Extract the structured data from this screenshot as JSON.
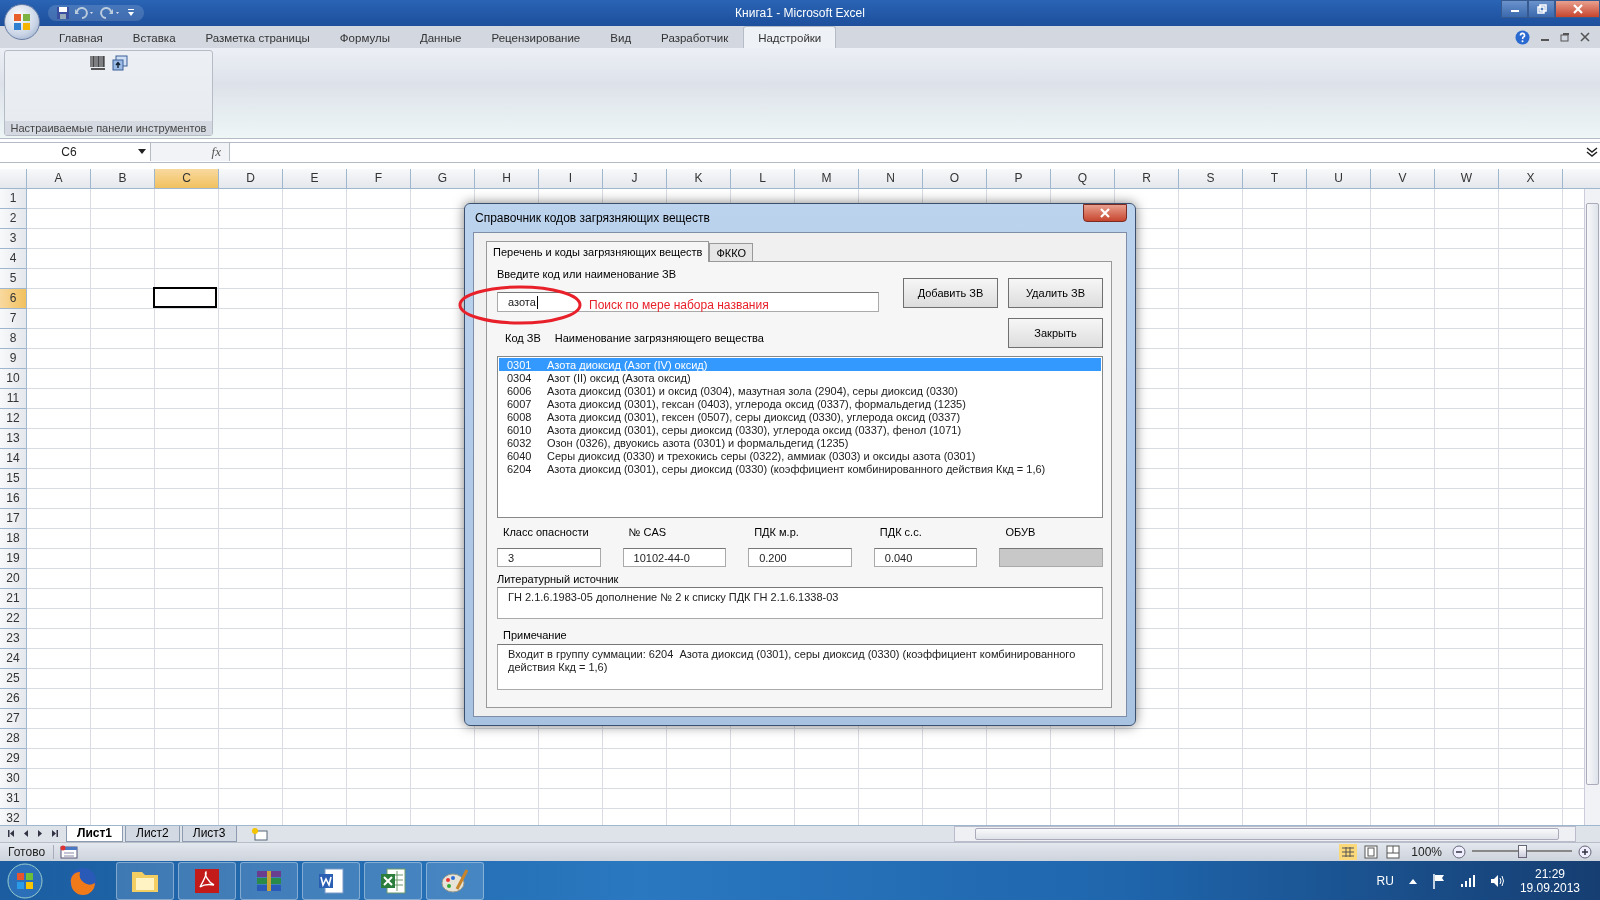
{
  "window": {
    "title": "Книга1 - Microsoft Excel"
  },
  "ribbon_tabs": [
    {
      "label": "Главная",
      "selected": false
    },
    {
      "label": "Вставка",
      "selected": false
    },
    {
      "label": "Разметка страницы",
      "selected": false
    },
    {
      "label": "Формулы",
      "selected": false
    },
    {
      "label": "Данные",
      "selected": false
    },
    {
      "label": "Рецензирование",
      "selected": false
    },
    {
      "label": "Вид",
      "selected": false
    },
    {
      "label": "Разработчик",
      "selected": false
    },
    {
      "label": "Надстройки",
      "selected": true
    }
  ],
  "ribbon_group": {
    "label": "Настраиваемые панели инструментов"
  },
  "name_box": {
    "value": "C6"
  },
  "formula_bar": {
    "function_label": "fx"
  },
  "columns": [
    {
      "label": "A",
      "selected": false
    },
    {
      "label": "B",
      "selected": false
    },
    {
      "label": "C",
      "selected": true
    },
    {
      "label": "D",
      "selected": false
    },
    {
      "label": "E",
      "selected": false
    },
    {
      "label": "F",
      "selected": false
    },
    {
      "label": "G",
      "selected": false
    },
    {
      "label": "H",
      "selected": false
    },
    {
      "label": "I",
      "selected": false
    },
    {
      "label": "J",
      "selected": false
    },
    {
      "label": "K",
      "selected": false
    },
    {
      "label": "L",
      "selected": false
    },
    {
      "label": "M",
      "selected": false
    },
    {
      "label": "N",
      "selected": false
    },
    {
      "label": "O",
      "selected": false
    },
    {
      "label": "P",
      "selected": false
    },
    {
      "label": "Q",
      "selected": false
    },
    {
      "label": "R",
      "selected": false
    },
    {
      "label": "S",
      "selected": false
    },
    {
      "label": "T",
      "selected": false
    },
    {
      "label": "U",
      "selected": false
    },
    {
      "label": "V",
      "selected": false
    },
    {
      "label": "W",
      "selected": false
    },
    {
      "label": "X",
      "selected": false
    }
  ],
  "rows": [
    {
      "label": "1",
      "selected": false
    },
    {
      "label": "2",
      "selected": false
    },
    {
      "label": "3",
      "selected": false
    },
    {
      "label": "4",
      "selected": false
    },
    {
      "label": "5",
      "selected": false
    },
    {
      "label": "6",
      "selected": true
    },
    {
      "label": "7",
      "selected": false
    },
    {
      "label": "8",
      "selected": false
    },
    {
      "label": "9",
      "selected": false
    },
    {
      "label": "10",
      "selected": false
    },
    {
      "label": "11",
      "selected": false
    },
    {
      "label": "12",
      "selected": false
    },
    {
      "label": "13",
      "selected": false
    },
    {
      "label": "14",
      "selected": false
    },
    {
      "label": "15",
      "selected": false
    },
    {
      "label": "16",
      "selected": false
    },
    {
      "label": "17",
      "selected": false
    },
    {
      "label": "18",
      "selected": false
    },
    {
      "label": "19",
      "selected": false
    },
    {
      "label": "20",
      "selected": false
    },
    {
      "label": "21",
      "selected": false
    },
    {
      "label": "22",
      "selected": false
    },
    {
      "label": "23",
      "selected": false
    },
    {
      "label": "24",
      "selected": false
    },
    {
      "label": "25",
      "selected": false
    },
    {
      "label": "26",
      "selected": false
    },
    {
      "label": "27",
      "selected": false
    },
    {
      "label": "28",
      "selected": false
    },
    {
      "label": "29",
      "selected": false
    },
    {
      "label": "30",
      "selected": false
    },
    {
      "label": "31",
      "selected": false
    },
    {
      "label": "32",
      "selected": false
    }
  ],
  "dialog": {
    "title": "Справочник кодов загрязняющих веществ",
    "tabs": [
      {
        "label": "Перечень и коды загрязняющих веществ",
        "selected": true
      },
      {
        "label": "ФККО",
        "selected": false
      }
    ],
    "search": {
      "label": "Введите код или наименование ЗВ",
      "value": "азота"
    },
    "buttons": [
      "Добавить ЗВ",
      "Удалить ЗВ",
      "Закрыть"
    ],
    "list_headers": [
      "Код ЗВ",
      "Наименование загрязняющего вещества"
    ],
    "items": [
      {
        "code": "0301",
        "name": "Азота диоксид (Азот (IV) оксид)",
        "selected": true
      },
      {
        "code": "0304",
        "name": "Азот (II) оксид (Азота оксид)",
        "selected": false
      },
      {
        "code": "6006",
        "name": "Азота диоксид (0301) и оксид (0304), мазутная зола (2904), серы диоксид (0330)",
        "selected": false
      },
      {
        "code": "6007",
        "name": "Азота диоксид (0301), гексан (0403), углерода оксид (0337), формальдегид (1235)",
        "selected": false
      },
      {
        "code": "6008",
        "name": "Азота диоксид (0301), гексен (0507), серы диоксид (0330), углерода оксид (0337)",
        "selected": false
      },
      {
        "code": "6010",
        "name": "Азота диоксид (0301), серы диоксид (0330), углерода оксид (0337), фенол (1071)",
        "selected": false
      },
      {
        "code": "6032",
        "name": "Озон (0326), двуокись азота (0301) и формальдегид (1235)",
        "selected": false
      },
      {
        "code": "6040",
        "name": "Серы диоксид (0330) и трехокись серы (0322), аммиак (0303) и оксиды азота (0301)",
        "selected": false
      },
      {
        "code": "6204",
        "name": "Азота диоксид (0301), серы диоксид (0330) (коэффициент комбинированного действия Ккд = 1,6)",
        "selected": false
      }
    ],
    "fields": [
      {
        "label": "Класс опасности",
        "value": "3",
        "disabled": false
      },
      {
        "label": "№ CAS",
        "value": "10102-44-0",
        "disabled": false
      },
      {
        "label": "ПДК м.р.",
        "value": "0.200",
        "disabled": false
      },
      {
        "label": "ПДК с.с.",
        "value": "0.040",
        "disabled": false
      },
      {
        "label": "ОБУВ",
        "disabled": true
      }
    ],
    "source": {
      "label": "Литературный источник",
      "value": "ГН 2.1.6.1983-05 дополнение № 2 к списку ПДК ГН 2.1.6.1338-03"
    },
    "note": {
      "label": "Примечание",
      "value": "Входит в группу суммации: 6204  Азота диоксид (0301), серы диоксид (0330) (коэффициент комбинированного действия Ккд = 1,6)"
    }
  },
  "annotation": {
    "text": "Поиск по мере набора названия"
  },
  "sheet_tabs": [
    {
      "label": "Лист1",
      "selected": true
    },
    {
      "label": "Лист2",
      "selected": false
    },
    {
      "label": "Лист3",
      "selected": false
    }
  ],
  "status_bar": {
    "text": "Готово",
    "zoom": "100%",
    "zoom_slider": {
      "level": 0.5
    }
  },
  "taskbar": {
    "language": "RU",
    "time": "21:29",
    "date": "19.09.2013"
  }
}
